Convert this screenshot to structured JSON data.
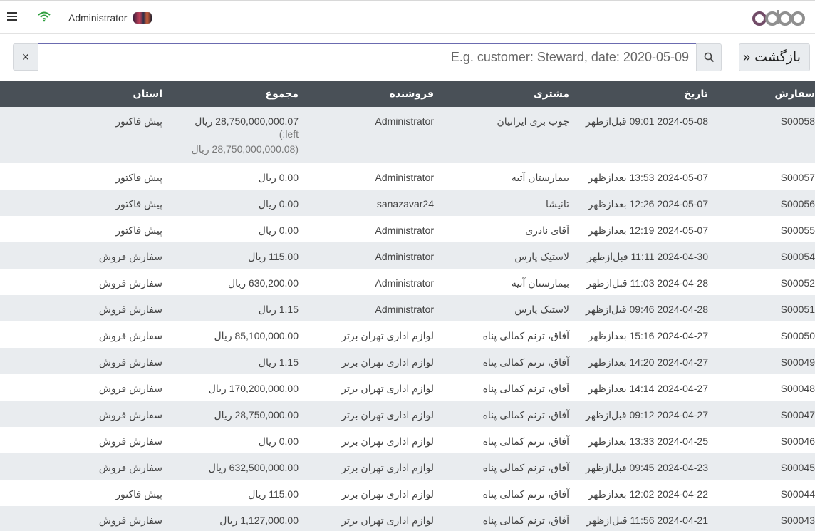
{
  "header": {
    "user_name": "Administrator",
    "logo_text": "odoo"
  },
  "search": {
    "placeholder": "E.g. customer: Steward, date: 2020-05-09",
    "clear_label": "×",
    "back_label": "بازگشت",
    "back_chevron": "«"
  },
  "table": {
    "columns": {
      "order": "سفارش",
      "date": "تاریخ",
      "customer": "مشتری",
      "seller": "فروشنده",
      "total": "مجموع",
      "state": "استان"
    },
    "rows": [
      {
        "order": "S00058",
        "date": "2024-05-08 09:01 قبل‌ازظهر",
        "customer": "چوب بری ایرانیان",
        "seller": "Administrator",
        "total": "28,750,000,000.07 ریال",
        "total_sub1": "left:)",
        "total_sub2": "(28,750,000,000.08 ریال",
        "state": "پیش فاکتور"
      },
      {
        "order": "S00057",
        "date": "2024-05-07 13:53 بعدازظهر",
        "customer": "بیمارستان آتیه",
        "seller": "Administrator",
        "total": "0.00 ریال",
        "state": "پیش فاکتور"
      },
      {
        "order": "S00056",
        "date": "2024-05-07 12:26 بعدازظهر",
        "customer": "تانیشا",
        "seller": "sanazavar24",
        "total": "0.00 ریال",
        "state": "پیش فاکتور"
      },
      {
        "order": "S00055",
        "date": "2024-05-07 12:19 بعدازظهر",
        "customer": "آقای نادری",
        "seller": "Administrator",
        "total": "0.00 ریال",
        "state": "پیش فاکتور"
      },
      {
        "order": "S00054",
        "date": "2024-04-30 11:11 قبل‌ازظهر",
        "customer": "لاستیک پارس",
        "seller": "Administrator",
        "total": "115.00 ریال",
        "state": "سفارش فروش"
      },
      {
        "order": "S00052",
        "date": "2024-04-28 11:03 قبل‌ازظهر",
        "customer": "بیمارستان آتیه",
        "seller": "Administrator",
        "total": "630,200.00 ریال",
        "state": "سفارش فروش"
      },
      {
        "order": "S00051",
        "date": "2024-04-28 09:46 قبل‌ازظهر",
        "customer": "لاستیک پارس",
        "seller": "Administrator",
        "total": "1.15 ریال",
        "state": "سفارش فروش"
      },
      {
        "order": "S00050",
        "date": "2024-04-27 15:16 بعدازظهر",
        "customer": "آفاق، ترنم کمالی پناه",
        "seller": "لوازم اداری تهران برتر",
        "total": "85,100,000.00 ریال",
        "state": "سفارش فروش"
      },
      {
        "order": "S00049",
        "date": "2024-04-27 14:20 بعدازظهر",
        "customer": "آفاق، ترنم کمالی پناه",
        "seller": "لوازم اداری تهران برتر",
        "total": "1.15 ریال",
        "state": "سفارش فروش"
      },
      {
        "order": "S00048",
        "date": "2024-04-27 14:14 بعدازظهر",
        "customer": "آفاق، ترنم کمالی پناه",
        "seller": "لوازم اداری تهران برتر",
        "total": "170,200,000.00 ریال",
        "state": "سفارش فروش"
      },
      {
        "order": "S00047",
        "date": "2024-04-27 09:12 قبل‌ازظهر",
        "customer": "آفاق، ترنم کمالی پناه",
        "seller": "لوازم اداری تهران برتر",
        "total": "28,750,000.00 ریال",
        "state": "سفارش فروش"
      },
      {
        "order": "S00046",
        "date": "2024-04-25 13:33 بعدازظهر",
        "customer": "آفاق، ترنم کمالی پناه",
        "seller": "لوازم اداری تهران برتر",
        "total": "0.00 ریال",
        "state": "سفارش فروش"
      },
      {
        "order": "S00045",
        "date": "2024-04-23 09:45 قبل‌ازظهر",
        "customer": "آفاق، ترنم کمالی پناه",
        "seller": "لوازم اداری تهران برتر",
        "total": "632,500,000.00 ریال",
        "state": "سفارش فروش"
      },
      {
        "order": "S00044",
        "date": "2024-04-22 12:02 بعدازظهر",
        "customer": "آفاق، ترنم کمالی پناه",
        "seller": "لوازم اداری تهران برتر",
        "total": "115.00 ریال",
        "state": "پیش فاکتور"
      },
      {
        "order": "S00043",
        "date": "2024-04-21 11:56 قبل‌ازظهر",
        "customer": "آفاق، ترنم کمالی پناه",
        "seller": "لوازم اداری تهران برتر",
        "total": "1,127,000.00 ریال",
        "state": "سفارش فروش"
      }
    ]
  },
  "colors": {
    "header_bg": "#495057",
    "row_alt_bg": "#e9ecef",
    "wifi_green": "#2e9e3e",
    "logo_purple": "#714b67",
    "logo_gray": "#8f8f8f"
  },
  "icons": {
    "menu": "hamburger-icon",
    "network": "wifi-icon",
    "search": "search-icon",
    "clear": "close-icon",
    "back": "double-chevron-icon"
  }
}
